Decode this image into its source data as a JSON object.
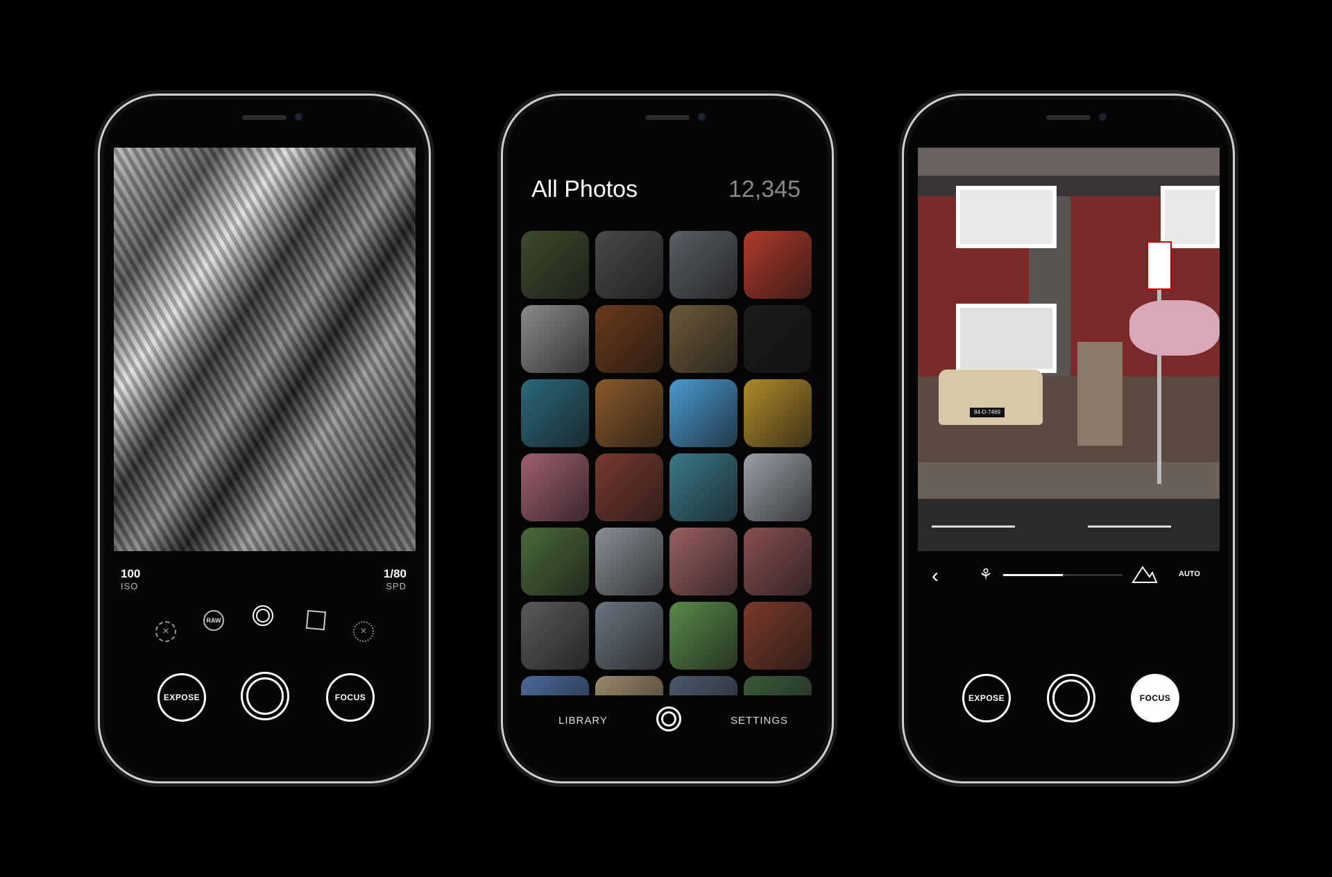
{
  "phone_left": {
    "iso": {
      "value": "100",
      "label": "ISO"
    },
    "speed": {
      "value": "1/80",
      "label": "SPD"
    },
    "mode_icons": [
      "timer-off-icon",
      "raw-icon",
      "live-circle-icon",
      "square-crop-icon",
      "grid-off-icon"
    ],
    "raw_label": "RAW",
    "expose_label": "EXPOSE",
    "focus_label": "FOCUS"
  },
  "phone_middle": {
    "title": "All Photos",
    "count": "12,345",
    "tiles": [
      "#3d4a2c",
      "#4a4a4a",
      "#5a5f66",
      "#b03a2a",
      "#8a8a8a",
      "#6a3a1a",
      "#6b5a3a",
      "#1a1a1a",
      "#2a6a7a",
      "#8a5a2a",
      "#4a9ad0",
      "#b08a2a",
      "#a06070",
      "#7a3a30",
      "#3a7a8a",
      "#9aa0a8",
      "#4a6a3a",
      "#8a9098",
      "#9a6060",
      "#8a5050",
      "#5a5a5a",
      "#6a7580",
      "#5a8a4a",
      "#7a3a2a",
      "#4a6a9a",
      "#9a8a6a",
      "#4a5a6a",
      "#3a5a3a"
    ],
    "nav": {
      "library": "LIBRARY",
      "settings": "SETTINGS"
    }
  },
  "phone_right": {
    "focus_slider": {
      "value": 0.5,
      "mode": "AUTO"
    },
    "expose_label": "EXPOSE",
    "focus_label": "FOCUS",
    "sign_text": "84-D-7469"
  }
}
